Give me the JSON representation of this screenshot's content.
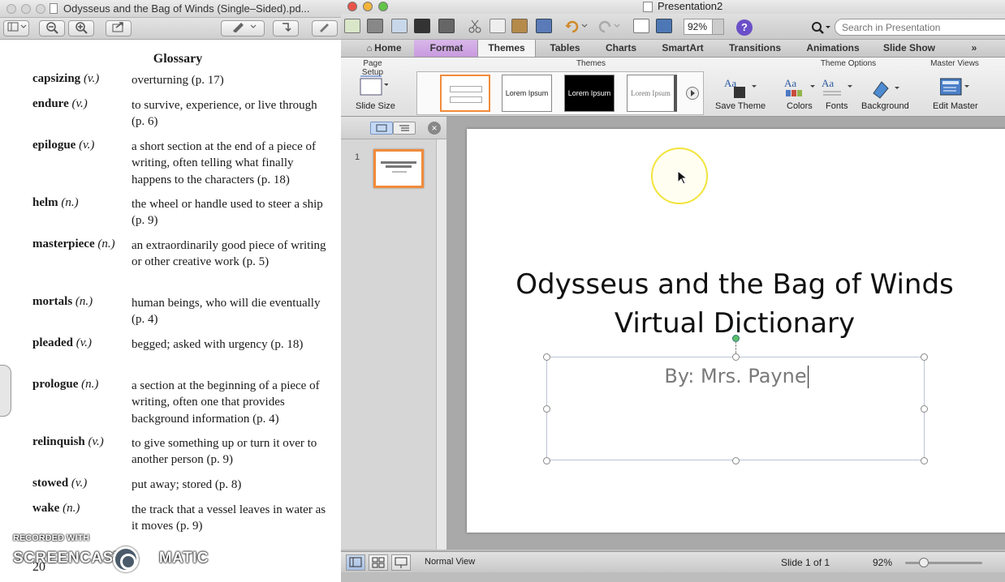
{
  "pdf_viewer": {
    "title": "Odysseus and the Bag of Winds (Single–Sided).pd...",
    "glossary_title": "Glossary",
    "entries": [
      {
        "term": "capsizing",
        "pos": "(v.)",
        "def": "overturning (p. 17)"
      },
      {
        "term": "endure",
        "pos": "(v.)",
        "def": "to survive, experience, or live through (p. 6)"
      },
      {
        "term": "epilogue",
        "pos": "(v.)",
        "def": "a short section at the end of a piece of writing, often telling what finally happens to the characters (p. 18)"
      },
      {
        "term": "helm",
        "pos": "(n.)",
        "def": "the wheel or handle used to steer a ship (p. 9)"
      },
      {
        "term": "masterpiece",
        "pos": "(n.)",
        "def": "an extraordinarily good piece of writing or other creative work (p. 5)"
      },
      {
        "term": "mortals",
        "pos": "(n.)",
        "def": "human beings, who will die eventually (p. 4)"
      },
      {
        "term": "pleaded",
        "pos": "(v.)",
        "def": "begged; asked with urgency (p. 18)"
      },
      {
        "term": "prologue",
        "pos": "(n.)",
        "def": "a section at the beginning of a piece of writing, often one that provides background information (p. 4)"
      },
      {
        "term": "relinquish",
        "pos": "(v.)",
        "def": "to give something up or turn it over to another person (p. 9)"
      },
      {
        "term": "stowed",
        "pos": "(v.)",
        "def": "put away; stored (p. 8)"
      },
      {
        "term": "wake",
        "pos": "(n.)",
        "def": "the track that a vessel leaves in water as it moves (p. 9)"
      }
    ],
    "page_number": "20"
  },
  "watermark": {
    "small": "RECORDED WITH",
    "left": "SCREENCAST",
    "right": "MATIC"
  },
  "powerpoint": {
    "title": "Presentation2",
    "zoom": "92%",
    "help": "?",
    "search_placeholder": "Search in Presentation",
    "tabs": [
      "Home",
      "Format",
      "Themes",
      "Tables",
      "Charts",
      "SmartArt",
      "Transitions",
      "Animations",
      "Slide Show"
    ],
    "tabs_more": "»",
    "ribbon": {
      "page_setup_label": "Page Setup",
      "slide_size": "Slide Size",
      "themes_label": "Themes",
      "theme_options_label": "Theme Options",
      "master_views_label": "Master Views",
      "theme_thumbs": [
        "",
        "Lorem Ipsum",
        "Lorem Ipsum",
        "Lorem Ipsum"
      ],
      "save_theme": "Save Theme",
      "colors": "Colors",
      "fonts": "Fonts",
      "background": "Background",
      "edit_master": "Edit Master"
    },
    "thumb_number": "1",
    "slide": {
      "title_line1": "Odysseus and the Bag of Winds",
      "title_line2": "Virtual Dictionary",
      "subtitle": "By: Mrs. Payne"
    },
    "status": {
      "view": "Normal View",
      "slide": "Slide 1 of 1",
      "zoom": "92%"
    },
    "colors": {
      "format_tab": "#c89ade",
      "thumb_border": "#f18b3b",
      "cursor_ring": "#f2e43a"
    }
  }
}
